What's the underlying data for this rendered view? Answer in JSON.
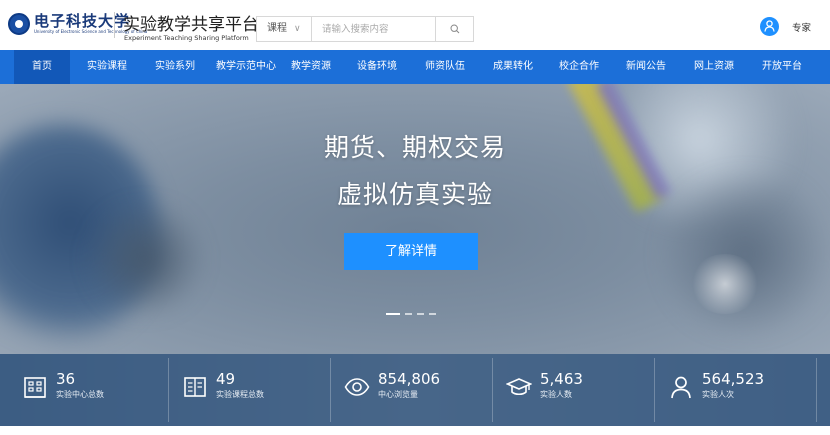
{
  "header": {
    "university_name": "电子科技大学",
    "university_name_en": "University of Electronic Science and Technology of China",
    "site_title": "实验教学共享平台",
    "site_subtitle": "Experiment Teaching Sharing Platform",
    "search": {
      "category": "课程",
      "placeholder": "请输入搜索内容"
    },
    "user_name": "专家"
  },
  "nav": {
    "items": [
      {
        "label": "首页",
        "active": true
      },
      {
        "label": "实验课程"
      },
      {
        "label": "实验系列"
      },
      {
        "label": "教学示范中心"
      },
      {
        "label": "教学资源"
      },
      {
        "label": "设备环境"
      },
      {
        "label": "师资队伍"
      },
      {
        "label": "成果转化"
      },
      {
        "label": "校企合作"
      },
      {
        "label": "新闻公告"
      },
      {
        "label": "网上资源"
      },
      {
        "label": "开放平台"
      }
    ]
  },
  "banner": {
    "line1": "期货、期权交易",
    "line2": "虚拟仿真实验",
    "cta_label": "了解详情",
    "slide_count": 4,
    "active_slide": 1
  },
  "stats": [
    {
      "icon": "building-icon",
      "value": "36",
      "label": "实验中心总数"
    },
    {
      "icon": "book-icon",
      "value": "49",
      "label": "实验课程总数"
    },
    {
      "icon": "eye-icon",
      "value": "854,806",
      "label": "中心浏览量"
    },
    {
      "icon": "graduation-cap-icon",
      "value": "5,463",
      "label": "实验人数"
    },
    {
      "icon": "user-icon",
      "value": "564,523",
      "label": "实验人次"
    }
  ],
  "colors": {
    "nav_blue": "#1c6fd8",
    "nav_active": "#1258b8",
    "cta_blue": "#1e90ff",
    "avatar_blue": "#1e90ff"
  }
}
